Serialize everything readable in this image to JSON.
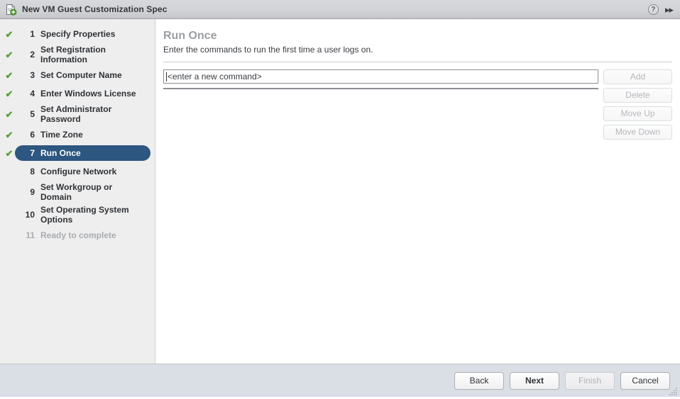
{
  "titlebar": {
    "doc_icon": "new-document-icon",
    "title": "New VM Guest Customization Spec",
    "help_icon": "?",
    "expand_icon": "▸▸"
  },
  "sidebar": {
    "steps": [
      {
        "num": "1",
        "label": "Specify Properties",
        "check": "✔",
        "state": "done"
      },
      {
        "num": "2",
        "label": "Set Registration Information",
        "check": "✔",
        "state": "done"
      },
      {
        "num": "3",
        "label": "Set Computer Name",
        "check": "✔",
        "state": "done"
      },
      {
        "num": "4",
        "label": "Enter Windows License",
        "check": "✔",
        "state": "done"
      },
      {
        "num": "5",
        "label": "Set Administrator Password",
        "check": "✔",
        "state": "done"
      },
      {
        "num": "6",
        "label": "Time Zone",
        "check": "✔",
        "state": "done"
      },
      {
        "num": "7",
        "label": "Run Once",
        "check": "✔",
        "state": "active"
      },
      {
        "num": "8",
        "label": "Configure Network",
        "check": "",
        "state": "todo"
      },
      {
        "num": "9",
        "label": "Set Workgroup or Domain",
        "check": "",
        "state": "todo"
      },
      {
        "num": "10",
        "label": "Set Operating System Options",
        "check": "",
        "state": "todo"
      },
      {
        "num": "11",
        "label": "Ready to complete",
        "check": "",
        "state": "disabled"
      }
    ]
  },
  "main": {
    "title": "Run Once",
    "description": "Enter the commands to run the first time a user logs on.",
    "command_input": {
      "value": "<enter a new command>",
      "placeholder": "<enter a new command>"
    },
    "command_list": {
      "items": []
    },
    "buttons": [
      {
        "label": "Add",
        "enabled": false
      },
      {
        "label": "Delete",
        "enabled": false
      },
      {
        "label": "Move Up",
        "enabled": false
      },
      {
        "label": "Move Down",
        "enabled": false
      }
    ]
  },
  "footer": {
    "buttons": [
      {
        "label": "Back",
        "enabled": true,
        "primary": false
      },
      {
        "label": "Next",
        "enabled": true,
        "primary": true
      },
      {
        "label": "Finish",
        "enabled": false,
        "primary": false
      },
      {
        "label": "Cancel",
        "enabled": true,
        "primary": false
      }
    ]
  },
  "colors": {
    "accent": "#2d5680",
    "check_green": "#5a9e3a",
    "sidebar_bg": "#eeeeee",
    "footer_bg": "#dadee5",
    "title_gray": "#9b9ea2"
  }
}
